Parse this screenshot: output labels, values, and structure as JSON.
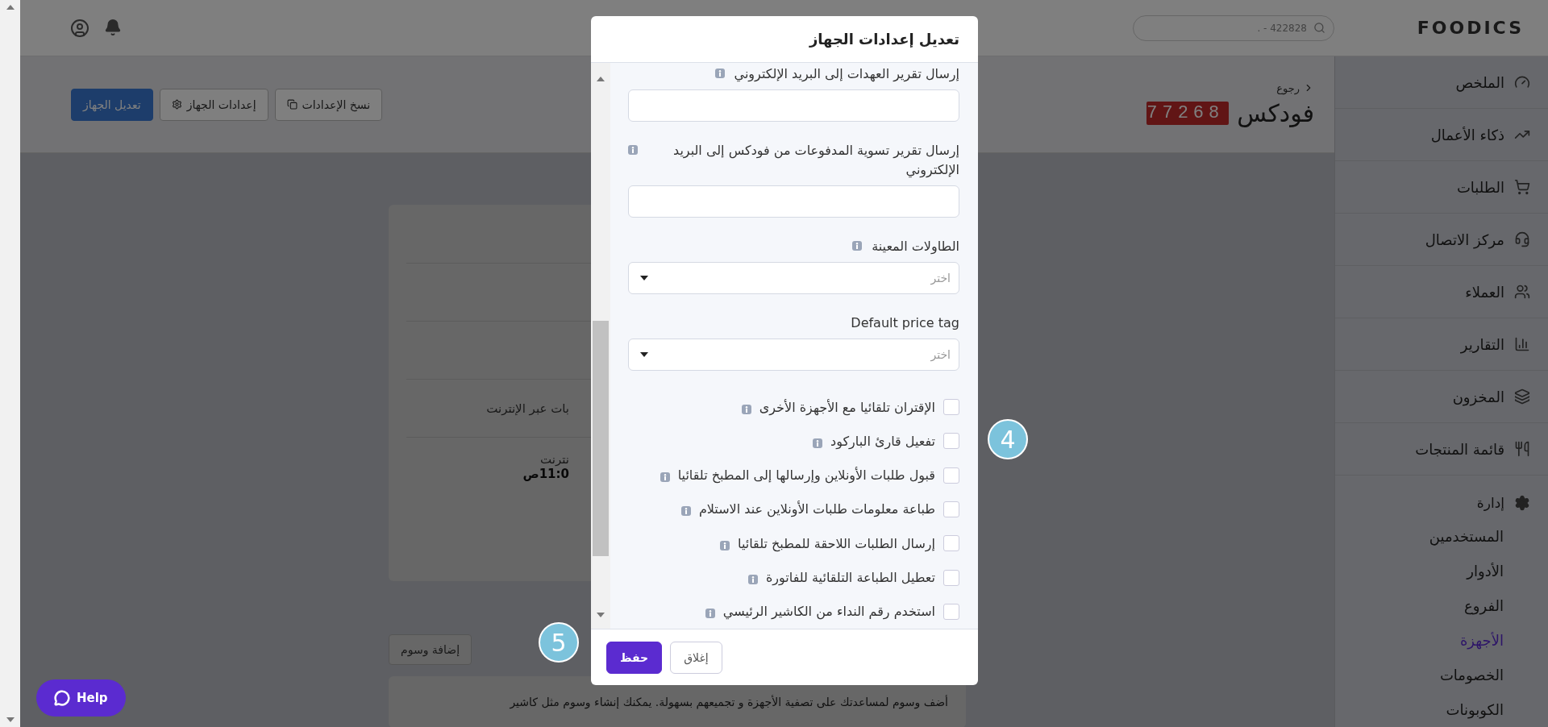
{
  "topbar": {
    "logo": "FOODICS",
    "search": {
      "value": "422828 - ."
    }
  },
  "sidebar": {
    "items": [
      {
        "label": "الملخص",
        "selected": false
      },
      {
        "label": "ذكاء الأعمال",
        "selected": false
      },
      {
        "label": "الطلبات",
        "selected": false
      },
      {
        "label": "مركز الاتصال",
        "selected": false
      },
      {
        "label": "العملاء",
        "selected": false
      },
      {
        "label": "التقارير",
        "selected": false
      },
      {
        "label": "المخزون",
        "selected": false
      },
      {
        "label": "قائمة المنتجات",
        "selected": false
      }
    ],
    "group": {
      "label": "إدارة",
      "children": [
        {
          "label": "المستخدمين",
          "selected": false
        },
        {
          "label": "الأدوار",
          "selected": false
        },
        {
          "label": "الفروع",
          "selected": false
        },
        {
          "label": "الأجهزة",
          "selected": true
        },
        {
          "label": "الخصومات",
          "selected": false
        },
        {
          "label": "الكوبونات",
          "selected": false
        }
      ]
    }
  },
  "header": {
    "back": "رجوع",
    "title": "فودكس",
    "badge": "77268",
    "buttons": [
      {
        "label": "نسخ الإعدادات",
        "kind": "copy"
      },
      {
        "label": "إعدادات الجهاز",
        "kind": "settings"
      },
      {
        "label": "تعديل الجهاز",
        "kind": "primary"
      }
    ]
  },
  "device_card": {
    "rows": [
      {
        "kind": "empty"
      },
      {
        "kind": "empty"
      },
      {
        "kind": "text",
        "text": "بات عبر الإنترنت"
      },
      {
        "kind": "pair",
        "label": "نترنت",
        "value": "11:0ص"
      }
    ]
  },
  "tags": {
    "button": "إضافة وسوم",
    "description": "أضف وسوم لمساعدتك على تصفية الأجهزة و تجميعهم بسهولة. يمكنك إنشاء وسوم مثل كاشير"
  },
  "help": "Help",
  "modal": {
    "title": "تعديل إعدادات الجهاز",
    "fields": [
      {
        "kind": "text",
        "label": "إرسال تقرير العهدات إلى البريد الإلكتروني",
        "info": true
      },
      {
        "kind": "text",
        "label": "إرسال تقرير تسوية المدفوعات من فودكس إلى البريد الإلكتروني",
        "info": true
      },
      {
        "kind": "select",
        "label": "الطاولات المعينة",
        "info": true,
        "placeholder": "اختر"
      },
      {
        "kind": "select",
        "label": "Default price tag",
        "info": false,
        "placeholder": "اختر"
      }
    ],
    "checkboxes": [
      {
        "label": "الإقتران تلقائيا مع الأجهزة الأخرى",
        "checked": false
      },
      {
        "label": "تفعيل قارئ الباركود",
        "checked": false
      },
      {
        "label": "قبول طلبات الأونلاين وإرسالها إلى المطبخ تلقائيا",
        "checked": false
      },
      {
        "label": "طباعة معلومات طلبات الأونلاين عند الاستلام",
        "checked": false
      },
      {
        "label": "إرسال الطلبات اللاحقة للمطبخ تلقائيا",
        "checked": false
      },
      {
        "label": "تعطيل الطباعة التلقائية للفاتورة",
        "checked": false
      },
      {
        "label": "استخدم رقم النداء من الكاشير الرئيسي",
        "checked": false
      }
    ],
    "buttons": [
      {
        "label": "إغلاق",
        "kind": "secondary"
      },
      {
        "label": "حفظ",
        "kind": "primary"
      }
    ]
  },
  "callouts": [
    "4",
    "5"
  ]
}
